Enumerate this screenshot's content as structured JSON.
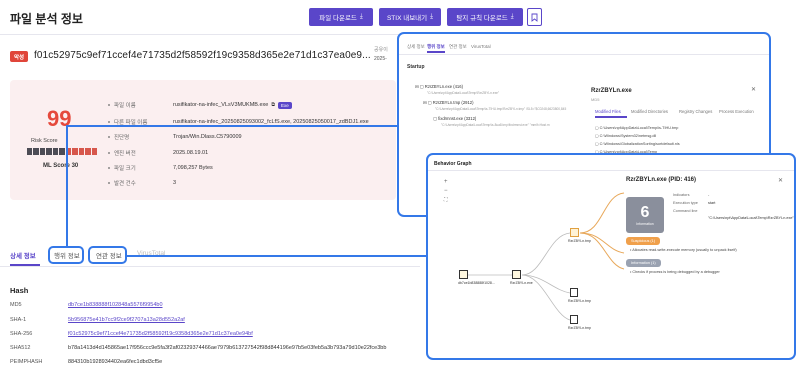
{
  "page": {
    "title": "파일 분석 정보",
    "buttons": {
      "file_download": "파일 다운로드",
      "stix_export": "STIX 내보내기",
      "detection_rule_download": "탐지 규칙 다운로드"
    }
  },
  "file": {
    "risk_badge": "악성",
    "sha256_title": "f01c52975c9ef71ccef4e71735d2f58592f19c9358d365e2e71d1c37ea0e9...",
    "side_label": "공유이",
    "side_value": "2025-"
  },
  "risk": {
    "score": "99",
    "score_label": "Risk Score",
    "ml_score": "ML Score 30"
  },
  "info": [
    {
      "key": "파일 이름",
      "value": "rusifikator-na-infec_VLsV3MUKMB.exe",
      "tag": "Exe"
    },
    {
      "key": "다른 파일 이름",
      "value": "rusifikator-na-infec_20250825093002_fcLfS.exe, 20250825050017_zdBDJ1.exe"
    },
    {
      "key": "진단명",
      "value": "Trojan/Win.Dlass.C5790009"
    },
    {
      "key": "엔진 버전",
      "value": "2025.08.19.01"
    },
    {
      "key": "파일 크기",
      "value": "7,098,257 Bytes"
    },
    {
      "key": "발견 건수",
      "value": "3"
    }
  ],
  "tabs": [
    "상세 정보",
    "행위 정보",
    "연관 정보",
    "VirusTotal"
  ],
  "hashes": {
    "title": "Hash",
    "rows": [
      {
        "key": "MD5",
        "value": "db7ce1b838888f102848a5576f9954b0"
      },
      {
        "key": "SHA-1",
        "value": "5b956875e41b7cc9f2ce9f2707a13a28d552a2af"
      },
      {
        "key": "SHA-256",
        "value": "f01c52975c9ef71ccef4e71735d2f58592f19c9358d365e2e71d1c37ea0e94bf"
      },
      {
        "key": "SHA512",
        "value": "b78a1413d4d145865ae17f956ccc9e5fa3f2af02329374466ae7979b613727542f98d844196e97b5e03feb5a3b793a79d10e22fce3bb"
      },
      {
        "key": "PEIMPHASH",
        "value": "884310b1928934402ea6fec1dbd3cf5e"
      }
    ]
  },
  "panel1": {
    "tabs": [
      "상세 정보",
      "행위 정보",
      "연관 정보",
      "VirusTotal"
    ],
    "section": "Startup",
    "tree": [
      {
        "label": "RzrZBYLn.exe (416)",
        "sub": "\"C:\\Users\\npt\\AppData\\Local\\Temp\\RzrZBYLn.exe\""
      },
      {
        "label": "RzrZBYLn.tmp (2912)",
        "sub": "\"C:\\Users\\npt\\AppData\\Local\\Temp\\is-TIHU.tmp\\RzrZBYLn.tmp\" /SL5=\"$C0248,6623800,845"
      },
      {
        "label": "fixdrmnst.exe (3312)",
        "sub": "\"C:\\Users\\npt\\AppData\\Local\\Temp\\is-8ua8.tmp\\fixdrmnst.exe\" \"mmlf=Host.m"
      }
    ],
    "detail_title": "RzrZBYLn.exe",
    "detail_sub": "MD5",
    "detail_tabs": [
      "Modified Files",
      "Modified Directories",
      "Registry Changes",
      "Process Execution"
    ],
    "files": [
      "C:\\Users\\npt\\AppData\\Local\\Temp\\is-TIHU.tmp",
      "C:\\Windows\\System32\\netmsg.dll",
      "C:\\Windows\\GlobalizationSorting\\sortdefault.nls",
      "C:\\Users\\npt\\AppData\\Local\\Temp",
      "C:\\Users\\npt\\AppData\\Local\\Temp\\is-8ua8.tmp"
    ]
  },
  "panel2": {
    "title": "Behavior Graph",
    "zoom_in": "+",
    "zoom_out": "−",
    "detail_title": "RzrZBYLn.exe (PID: 416)",
    "count": "6",
    "count_label": "Information",
    "fields": [
      {
        "key": "Indicators",
        "value": "-"
      },
      {
        "key": "Execution type",
        "value": "start"
      },
      {
        "key": "Command line",
        "value": "\"C:\\Users\\npt\\AppData\\Local\\Temp\\RzrZBYLn.exe\""
      }
    ],
    "suspicious_label": "Suspicious (1)",
    "suspicious_text": "Allocates read-write-execute memory (usually to unpack itself)",
    "information_label": "Information (1)",
    "information_text": "Checks if process is being debugged by a debugger",
    "nodes": {
      "root": "db7ce1b838888f1028...",
      "n1": "RzrZBYLn.exe",
      "n2": "RzrZBYLn.tmp",
      "n3": "RzrZBYLn.tmp",
      "n4": "RzrZBYLn.tmp"
    }
  },
  "colors": {
    "accent": "#5a46c9",
    "danger": "#e0453a",
    "highlight": "#3478e8",
    "suspicious": "#f0a04b",
    "information": "#9aa2b1"
  }
}
